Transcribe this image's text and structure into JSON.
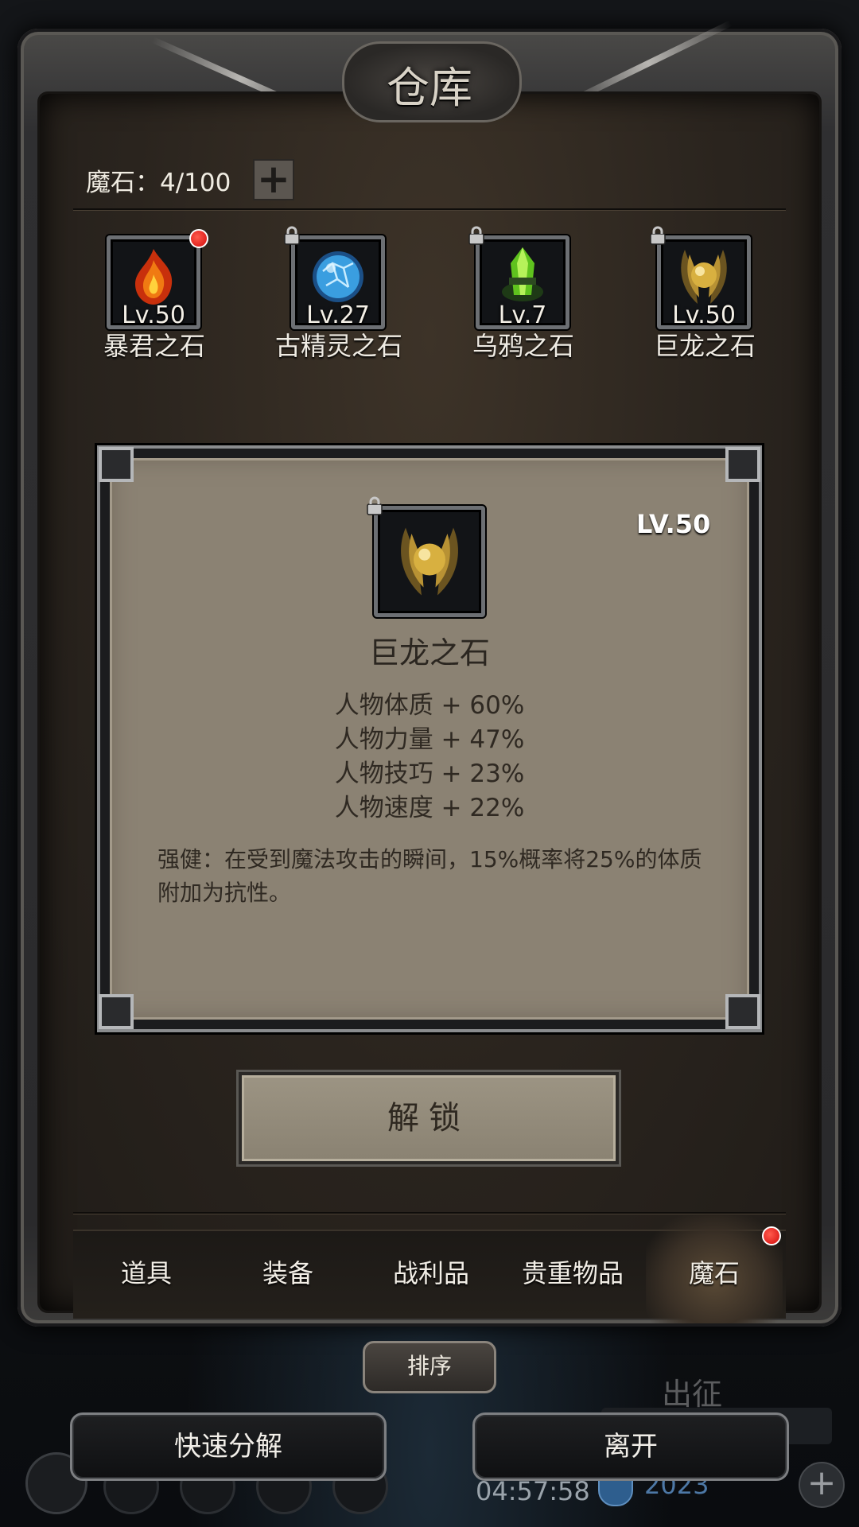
{
  "window": {
    "title": "仓库"
  },
  "capacity": {
    "text": "魔石：4/100",
    "add_label": "+"
  },
  "stones": [
    {
      "name": "暴君之石",
      "level": "Lv.50",
      "locked": false,
      "new": true,
      "gem": "fire-gem-icon",
      "color": "#e8501a"
    },
    {
      "name": "古精灵之石",
      "level": "Lv.27",
      "locked": true,
      "new": false,
      "gem": "blue-orb-icon",
      "color": "#3a9ee0"
    },
    {
      "name": "乌鸦之石",
      "level": "Lv.7",
      "locked": true,
      "new": false,
      "gem": "green-crystal-icon",
      "color": "#6fd02a"
    },
    {
      "name": "巨龙之石",
      "level": "Lv.50",
      "locked": true,
      "new": false,
      "gem": "golden-dragon-icon",
      "color": "#c9a030"
    }
  ],
  "detail": {
    "level": "LV.50",
    "name": "巨龙之石",
    "stats": [
      "人物体质 + 60%",
      "人物力量 + 47%",
      "人物技巧 + 23%",
      "人物速度 + 22%"
    ],
    "description": "强健：在受到魔法攻击的瞬间，15%概率将25%的体质附加为抗性。"
  },
  "unlock_label": "解锁",
  "tabs": [
    {
      "label": "道具"
    },
    {
      "label": "装备"
    },
    {
      "label": "战利品"
    },
    {
      "label": "贵重物品"
    },
    {
      "label": "魔石",
      "active": true,
      "badge": true
    }
  ],
  "sort_label": "排序",
  "quick_decompose_label": "快速分解",
  "leave_label": "离开",
  "background": {
    "expedition": "出征",
    "time": "04:57:58",
    "year": "2023"
  }
}
